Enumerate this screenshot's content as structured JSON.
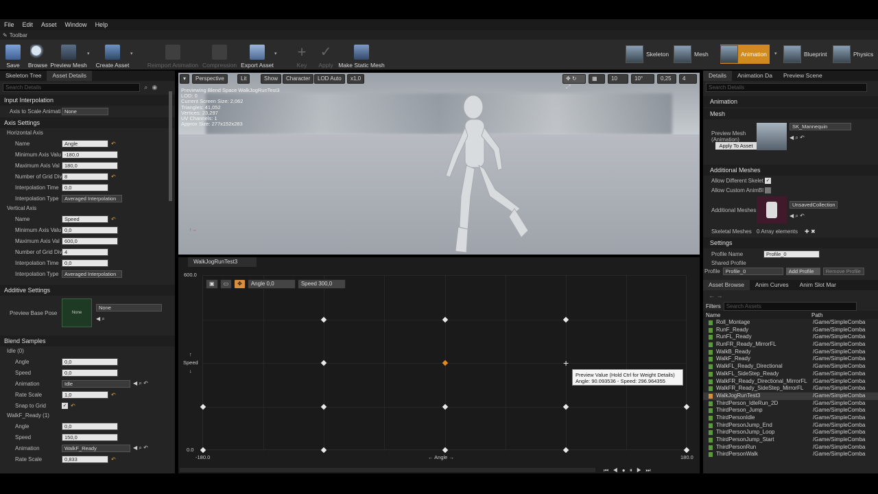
{
  "menu": [
    "File",
    "Edit",
    "Asset",
    "Window",
    "Help"
  ],
  "toolbar_tab": "Toolbar",
  "toolbar": {
    "buttons": [
      {
        "label": "Save",
        "enabled": true
      },
      {
        "label": "Browse",
        "enabled": true
      },
      {
        "label": "Preview Mesh",
        "enabled": true
      },
      {
        "label": "Create Asset",
        "enabled": true
      },
      {
        "label": "Reimport Animation",
        "enabled": false
      },
      {
        "label": "Compression",
        "enabled": false
      },
      {
        "label": "Export Asset",
        "enabled": true
      },
      {
        "label": "Key",
        "enabled": false
      },
      {
        "label": "Apply",
        "enabled": false
      },
      {
        "label": "Make Static Mesh",
        "enabled": true
      }
    ],
    "modes": [
      "Skeleton",
      "Mesh",
      "Animation",
      "Blueprint",
      "Physics"
    ],
    "active_mode": "Animation"
  },
  "left": {
    "tabs": [
      "Skeleton Tree",
      "Asset Details"
    ],
    "search_placeholder": "Search Details",
    "input_interpolation": {
      "section": "Input Interpolation",
      "axis_to_scale_label": "Axis to Scale Animati",
      "axis_to_scale_value": "None"
    },
    "axis_settings": {
      "section": "Axis Settings",
      "horizontal": {
        "title": "Horizontal Axis",
        "rows": [
          {
            "label": "Name",
            "value": "Angle"
          },
          {
            "label": "Minimum Axis Valu",
            "value": "-180,0"
          },
          {
            "label": "Maximum Axis Val",
            "value": "180,0"
          },
          {
            "label": "Number of Grid Divi",
            "value": "8"
          },
          {
            "label": "Interpolation Time",
            "value": "0,0"
          },
          {
            "label": "Interpolation Type",
            "value": "Averaged Interpolation"
          }
        ]
      },
      "vertical": {
        "title": "Vertical Axis",
        "rows": [
          {
            "label": "Name",
            "value": "Speed"
          },
          {
            "label": "Minimum Axis Valu",
            "value": "0,0"
          },
          {
            "label": "Maximum Axis Val",
            "value": "600,0"
          },
          {
            "label": "Number of Grid Divi",
            "value": "4"
          },
          {
            "label": "Interpolation Time",
            "value": "0,0"
          },
          {
            "label": "Interpolation Type",
            "value": "Averaged Interpolation"
          }
        ]
      }
    },
    "additive": {
      "section": "Additive Settings",
      "preview_base_pose_label": "Preview Base Pose",
      "thumb_label": "None",
      "value": "None"
    },
    "blend_samples": {
      "section": "Blend Samples",
      "samples": [
        {
          "title": "Idle (0)",
          "angle": "0,0",
          "speed": "0,0",
          "animation": "Idle",
          "rate_scale": "1,0",
          "snap_label": "Snap to Grid"
        },
        {
          "title": "WalkF_Ready (1)",
          "angle": "0,0",
          "speed": "150,0",
          "animation": "WalkF_Ready",
          "rate_scale": "0,833"
        }
      ],
      "labels": {
        "angle": "Angle",
        "speed": "Speed",
        "animation": "Animation",
        "rate_scale": "Rate Scale"
      }
    }
  },
  "viewport": {
    "buttons": [
      "Perspective",
      "Lit",
      "Show",
      "Character",
      "LOD Auto",
      "x1,0"
    ],
    "right_values": [
      "10",
      "10°",
      "0,25",
      "4"
    ],
    "stats": [
      "Previewing Blend Space WalkJogRunTest3",
      "LOD: 0",
      "Current Screen Size: 2,062",
      "Triangles: 41,052",
      "Vertices: 23,297",
      "UV Channels: 1",
      "Approx Size: 277x152x283"
    ]
  },
  "blendspace": {
    "tab": "WalkJogRunTest3",
    "angle_label": "Angle",
    "angle_value": "0,0",
    "speed_label": "Speed",
    "speed_value": "300,0",
    "y_max": "600.0",
    "y_min": "0.0",
    "x_min": "-180.0",
    "x_max": "180.0",
    "x_axis_name": "Angle",
    "y_axis_name": "Speed",
    "points": [
      {
        "angle": -90,
        "speed": 450
      },
      {
        "angle": 0,
        "speed": 450
      },
      {
        "angle": 90,
        "speed": 450
      },
      {
        "angle": -90,
        "speed": 300
      },
      {
        "angle": 0,
        "speed": 300,
        "selected": true
      },
      {
        "angle": -180,
        "speed": 150
      },
      {
        "angle": -90,
        "speed": 150
      },
      {
        "angle": 0,
        "speed": 150
      },
      {
        "angle": 90,
        "speed": 150
      },
      {
        "angle": 180,
        "speed": 150
      },
      {
        "angle": -180,
        "speed": 0
      },
      {
        "angle": -90,
        "speed": 0
      },
      {
        "angle": 0,
        "speed": 0
      },
      {
        "angle": 90,
        "speed": 0
      },
      {
        "angle": 180,
        "speed": 0
      }
    ],
    "tooltip_line1": "Preview Value (Hold Ctrl for Weight Details)",
    "tooltip_line2": "Angle: 90.093536 - Speed: 296.964355"
  },
  "right": {
    "tabs": [
      "Details",
      "Animation Da",
      "Preview Scene"
    ],
    "search_placeholder": "Search Details",
    "animation_section": "Animation",
    "mesh_section": "Mesh",
    "preview_mesh_label": "Preview Mesh (Animation)",
    "preview_mesh_value": "SK_Mannequin",
    "apply_button": "Apply To Asset",
    "additional_meshes_section": "Additional Meshes",
    "allow_diff_label": "Allow Different Skelet",
    "allow_custom_label": "Allow Custom AnimBl",
    "additional_meshes_label": "Additional Meshes",
    "additional_meshes_value": "UnsavedCollection",
    "skeletal_meshes_label": "Skeletal Meshes",
    "skeletal_meshes_value": "0 Array elements",
    "settings_section": "Settings",
    "profile_name_label": "Profile Name",
    "profile_name_value": "Profile_0",
    "shared_profile_label": "Shared Profile",
    "profile_label": "Profile",
    "profile_value": "Profile_0",
    "add_profile": "Add Profile",
    "remove_profile": "Remove Profile",
    "browser_tabs": [
      "Asset Browse",
      "Anim Curves",
      "Anim Slot Mar"
    ],
    "filters_label": "Filters",
    "search_assets_placeholder": "Search Assets",
    "col_name": "Name",
    "col_path": "Path",
    "assets": [
      {
        "name": "Roll_Montage",
        "path": "/Game/SimpleComba"
      },
      {
        "name": "RunF_Ready",
        "path": "/Game/SimpleComba"
      },
      {
        "name": "RunFL_Ready",
        "path": "/Game/SimpleComba"
      },
      {
        "name": "RunFR_Ready_MirrorFL",
        "path": "/Game/SimpleComba"
      },
      {
        "name": "WalkB_Ready",
        "path": "/Game/SimpleComba"
      },
      {
        "name": "WalkF_Ready",
        "path": "/Game/SimpleComba"
      },
      {
        "name": "WalkFL_Ready_Directional",
        "path": "/Game/SimpleComba"
      },
      {
        "name": "WalkFL_SideStep_Ready",
        "path": "/Game/SimpleComba"
      },
      {
        "name": "WalkFR_Ready_Directional_MirrorFL",
        "path": "/Game/SimpleComba"
      },
      {
        "name": "WalkFR_Ready_SideStep_MirrorFL",
        "path": "/Game/SimpleComba"
      },
      {
        "name": "WalkJogRunTest3",
        "path": "/Game/SimpleComba",
        "selected": true
      },
      {
        "name": "ThirdPerson_IdleRun_2D",
        "path": "/Game/SimpleComba"
      },
      {
        "name": "ThirdPerson_Jump",
        "path": "/Game/SimpleComba"
      },
      {
        "name": "ThirdPersonIdle",
        "path": "/Game/SimpleComba"
      },
      {
        "name": "ThirdPersonJump_End",
        "path": "/Game/SimpleComba"
      },
      {
        "name": "ThirdPersonJump_Loop",
        "path": "/Game/SimpleComba"
      },
      {
        "name": "ThirdPersonJump_Start",
        "path": "/Game/SimpleComba"
      },
      {
        "name": "ThirdPersonRun",
        "path": "/Game/SimpleComba"
      },
      {
        "name": "ThirdPersonWalk",
        "path": "/Game/SimpleComba"
      }
    ]
  },
  "colors": {
    "accent": "#e08a20",
    "active_mode": "#d08a1e",
    "panel": "#242424"
  }
}
